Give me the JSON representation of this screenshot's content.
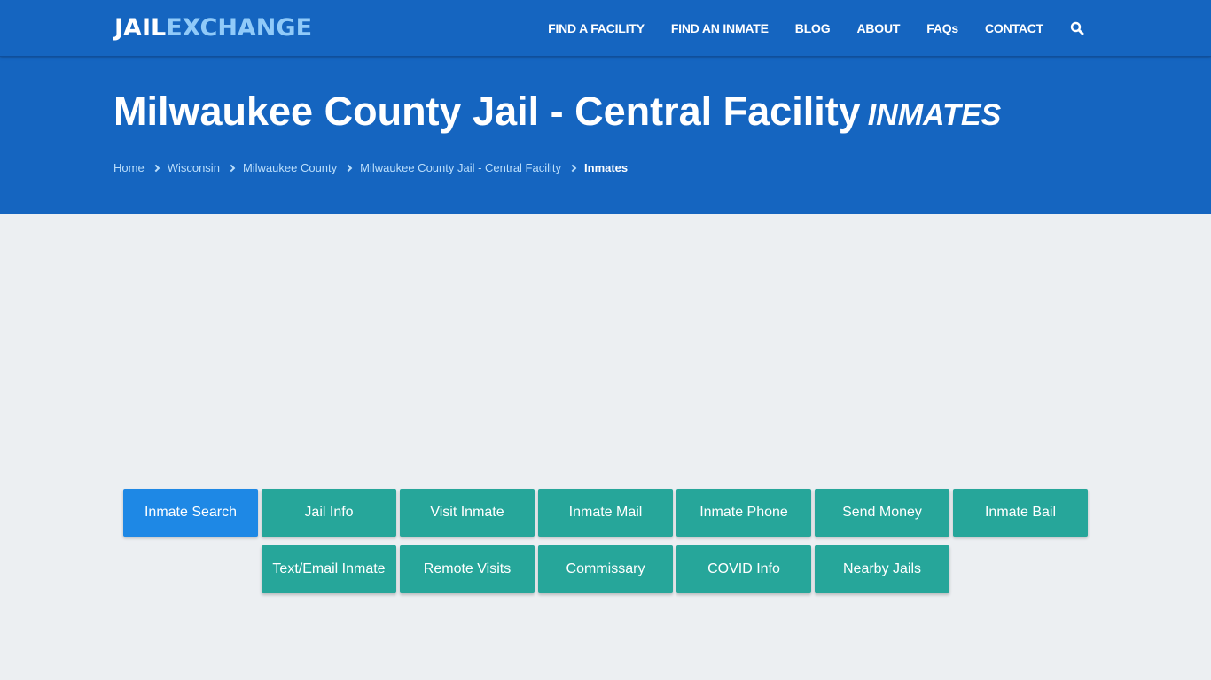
{
  "header": {
    "logo_part1": "JAIL",
    "logo_part2": "EXCHANGE",
    "nav": [
      {
        "label": "FIND A FACILITY"
      },
      {
        "label": "FIND AN INMATE"
      },
      {
        "label": "BLOG"
      },
      {
        "label": "ABOUT"
      },
      {
        "label": "FAQs"
      },
      {
        "label": "CONTACT"
      }
    ],
    "search_icon": "search-icon"
  },
  "hero": {
    "title": "Milwaukee County Jail - Central Facility",
    "subtitle": "INMATES",
    "breadcrumb": [
      {
        "label": "Home"
      },
      {
        "label": "Wisconsin"
      },
      {
        "label": "Milwaukee County"
      },
      {
        "label": "Milwaukee County Jail - Central Facility"
      },
      {
        "label": "Inmates"
      }
    ]
  },
  "actions": [
    {
      "label": "Inmate Search",
      "active": true
    },
    {
      "label": "Jail Info"
    },
    {
      "label": "Visit Inmate"
    },
    {
      "label": "Inmate Mail"
    },
    {
      "label": "Inmate Phone"
    },
    {
      "label": "Send Money"
    },
    {
      "label": "Inmate Bail"
    },
    {
      "label": "Text/Email Inmate"
    },
    {
      "label": "Remote Visits"
    },
    {
      "label": "Commissary"
    },
    {
      "label": "COVID Info"
    },
    {
      "label": "Nearby Jails"
    }
  ],
  "colors": {
    "brand_blue": "#1565c0",
    "logo_accent": "#90caf9",
    "active_button": "#1e88e5",
    "button_teal": "#26a69a",
    "page_background": "#eceff2"
  }
}
